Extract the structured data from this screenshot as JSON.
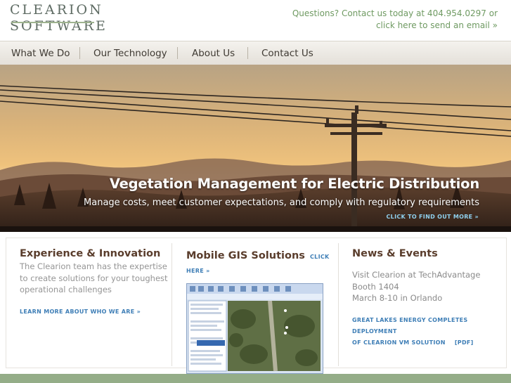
{
  "header": {
    "logo_line1": "CLEARION",
    "logo_line2": "SOFTWARE",
    "contact_line1": "Questions? Contact us today at 404.954.0297 or",
    "contact_line2": "click here to send an email »"
  },
  "nav": {
    "items": [
      {
        "label": "What We Do"
      },
      {
        "label": "Our Technology"
      },
      {
        "label": "About Us"
      },
      {
        "label": "Contact Us"
      }
    ]
  },
  "hero": {
    "title": "Vegetation Management for Electric Distribution",
    "subtitle": "Manage costs, meet customer expectations, and comply with regulatory requirements",
    "link": "CLICK TO FIND OUT MORE »"
  },
  "columns": {
    "experience": {
      "heading": "Experience & Innovation",
      "body": "The Clearion team has the expertise to create solutions for your toughest operational challenges",
      "link": "LEARN MORE ABOUT WHO WE ARE »"
    },
    "mobile": {
      "heading": "Mobile GIS Solutions",
      "link_a": "CLICK",
      "link_b": "HERE »"
    },
    "news": {
      "heading": "News & Events",
      "line1": "Visit Clearion at TechAdvantage",
      "line2": "Booth 1404",
      "line3": "March 8-10 in Orlando",
      "link1": "GREAT LAKES ENERGY COMPLETES DEPLOYMENT",
      "link2": "OF CLEARION VM SOLUTION",
      "link3": "[PDF]"
    }
  },
  "colors": {
    "brand_green": "#6f9a62",
    "heading_brown": "#5a3d2c",
    "link_blue": "#3e7eb6",
    "hero_link": "#8fd0ee"
  }
}
